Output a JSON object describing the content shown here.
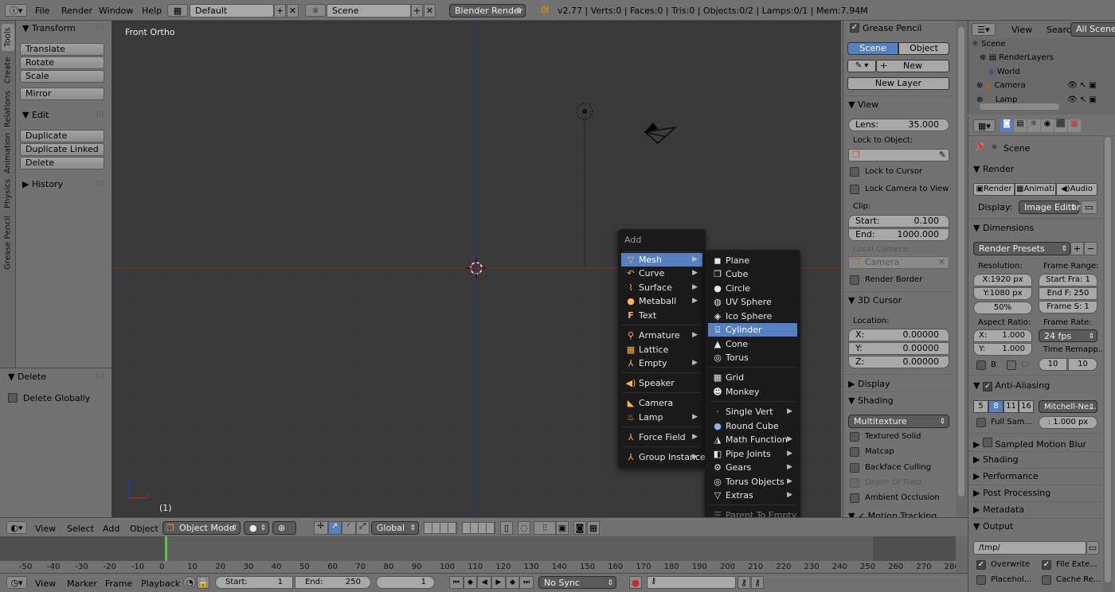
{
  "top_bar": {
    "menus": [
      "File",
      "Render",
      "Window",
      "Help"
    ],
    "screen_layout": "Default",
    "scene": "Scene",
    "render_engine": "Blender Render",
    "stats": "v2.77 | Verts:0 | Faces:0 | Tris:0 | Objects:0/2 | Lamps:0/1 | Mem:7.94M"
  },
  "left_tabs": [
    "Tools",
    "Create",
    "Relations",
    "Animation",
    "Physics",
    "Grease Pencil"
  ],
  "tool_shelf": {
    "transform_title": "Transform",
    "transform_buttons": [
      "Translate",
      "Rotate",
      "Scale"
    ],
    "mirror": "Mirror",
    "edit_title": "Edit",
    "edit_buttons": [
      "Duplicate",
      "Duplicate Linked",
      "Delete"
    ],
    "history_title": "History"
  },
  "operator_panel": {
    "title": "Delete",
    "option": "Delete Globally"
  },
  "viewport": {
    "view_label": "Front Ortho",
    "frame_label": "(1)"
  },
  "add_menu": {
    "title": "Add",
    "items": [
      "Mesh",
      "Curve",
      "Surface",
      "Metaball",
      "Text",
      "Armature",
      "Lattice",
      "Empty",
      "Speaker",
      "Camera",
      "Lamp",
      "Force Field",
      "Group Instance"
    ],
    "selected": "Mesh"
  },
  "mesh_menu": {
    "items": [
      "Plane",
      "Cube",
      "Circle",
      "UV Sphere",
      "Ico Sphere",
      "Cylinder",
      "Cone",
      "Torus",
      "Grid",
      "Monkey",
      "Single Vert",
      "Round Cube",
      "Math Function",
      "Pipe Joints",
      "Gears",
      "Torus Objects",
      "Extras",
      "Parent To Empty"
    ],
    "highlighted": "Cylinder"
  },
  "n_panel": {
    "grease_pencil": "Grease Pencil",
    "scene_btn": "Scene",
    "object_btn": "Object",
    "new_btn": "New",
    "new_layer_btn": "New Layer",
    "view_title": "View",
    "lens_label": "Lens:",
    "lens_value": "35.000",
    "lock_to_object": "Lock to Object:",
    "lock_to_cursor": "Lock to Cursor",
    "lock_camera": "Lock Camera to View",
    "clip_label": "Clip:",
    "clip_start_label": "Start:",
    "clip_start": "0.100",
    "clip_end_label": "End:",
    "clip_end": "1000.000",
    "local_camera": "Local Camera:",
    "camera_field": "Camera",
    "render_border": "Render Border",
    "cursor_title": "3D Cursor",
    "location_label": "Location:",
    "x_label": "X:",
    "x_value": "0.00000",
    "y_label": "Y:",
    "y_value": "0.00000",
    "z_label": "Z:",
    "z_value": "0.00000",
    "display_title": "Display",
    "shading_title": "Shading",
    "shading_mode": "Multitexture",
    "textured_solid": "Textured Solid",
    "matcap": "Matcap",
    "backface": "Backface Culling",
    "depth_of_field": "Depth Of Field",
    "ambient_occlusion": "Ambient Occlusion",
    "motion_tracking": "Motion Tracking"
  },
  "outliner": {
    "view": "View",
    "search": "Search",
    "all_scenes": "All Scenes",
    "rows": [
      "Scene",
      "RenderLayers",
      "World",
      "Camera",
      "Lamp"
    ]
  },
  "properties": {
    "scene_label": "Scene",
    "render_title": "Render",
    "render_btn": "Render",
    "animation_btn": "Animati",
    "audio_btn": "Audio",
    "display_label": "Display:",
    "display_value": "Image Editor",
    "dimensions_title": "Dimensions",
    "render_presets": "Render Presets",
    "resolution_label": "Resolution:",
    "frame_range_label": "Frame Range:",
    "res_x": "X:1920 px",
    "res_y": "Y:1080 px",
    "res_pct": "50%",
    "start_frame": "Start Fra: 1",
    "end_frame": "End F: 250",
    "frame_step": "Frame S: 1",
    "aspect_label": "Aspect Ratio:",
    "framerate_label": "Frame Rate:",
    "aspect_x_label": "X:",
    "aspect_x": "1.000",
    "aspect_y_label": "Y:",
    "aspect_y": "1.000",
    "fps": "24 fps",
    "time_remap": "Time Remapp...",
    "border_b": "B",
    "crop_cr": "Cr",
    "remap_old": "10",
    "remap_new": "10",
    "aa_title": "Anti-Aliasing",
    "aa_samples": [
      "5",
      "8",
      "11",
      "16"
    ],
    "aa_filter": "Mitchell-Ne...",
    "full_sample": "Full Sam...",
    "filter_size": ": 1.000 px",
    "motion_blur": "Sampled Motion Blur",
    "shading": "Shading",
    "performance": "Performance",
    "post_processing": "Post Processing",
    "metadata": "Metadata",
    "output": "Output",
    "output_path": "/tmp/",
    "overwrite": "Overwrite",
    "file_ext": "File Exte...",
    "placeholders": "Placehol...",
    "cache_result": "Cache Re..."
  },
  "viewport_header": {
    "menus": [
      "View",
      "Select",
      "Add",
      "Object"
    ],
    "mode": "Object Mode",
    "orientation": "Global"
  },
  "timeline": {
    "ticks": [
      "-50",
      "-40",
      "-30",
      "-20",
      "-10",
      "0",
      "10",
      "20",
      "30",
      "40",
      "50",
      "60",
      "70",
      "80",
      "90",
      "100",
      "110",
      "120",
      "130",
      "140",
      "150",
      "160",
      "170",
      "180",
      "190",
      "200",
      "210",
      "220",
      "230",
      "240",
      "250",
      "260",
      "270",
      "280"
    ],
    "current_frame_marker": 0
  },
  "timeline_footer": {
    "menus": [
      "View",
      "Marker",
      "Frame",
      "Playback"
    ],
    "start_label": "Start:",
    "start_value": "1",
    "end_label": "End:",
    "end_value": "250",
    "current": "1",
    "sync": "No Sync"
  }
}
